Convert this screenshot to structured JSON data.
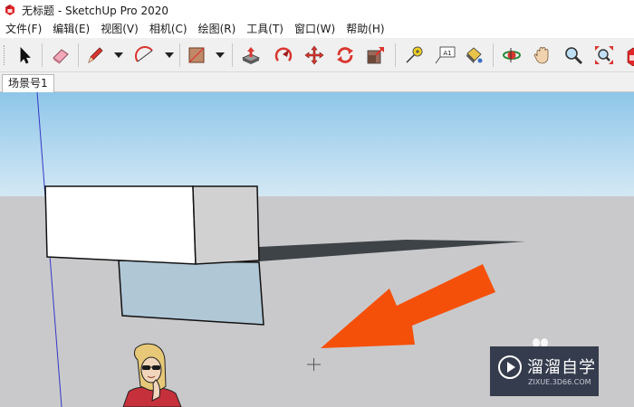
{
  "window": {
    "title": "无标题 - SketchUp Pro 2020",
    "accent_color": "#e0262a"
  },
  "menu": [
    {
      "label": "文件(F)"
    },
    {
      "label": "编辑(E)"
    },
    {
      "label": "视图(V)"
    },
    {
      "label": "相机(C)"
    },
    {
      "label": "绘图(R)"
    },
    {
      "label": "工具(T)"
    },
    {
      "label": "窗口(W)"
    },
    {
      "label": "帮助(H)"
    }
  ],
  "toolbar": {
    "icons": [
      "select-icon",
      "eraser-icon",
      "pencil-line-icon",
      "arc-icon",
      "rectangle-icon",
      "push-pull-icon",
      "follow-me-icon",
      "move-icon",
      "rotate-icon",
      "scale-icon",
      "tape-measure-icon",
      "text-label-icon",
      "paint-bucket-icon",
      "orbit-icon",
      "pan-icon",
      "zoom-icon",
      "zoom-extents-icon",
      "warehouse-icon"
    ],
    "text_tool_glyph": "A1"
  },
  "scenes": {
    "tabs": [
      {
        "label": "场景号1"
      }
    ]
  },
  "viewport": {
    "sky_color": "#8ec6e9",
    "ground_color": "#c9c9cb",
    "annotation_arrow_color": "#f5500a"
  },
  "watermark": {
    "title": "溜溜自学",
    "subtitle": "ZIXUE.3D66.COM"
  }
}
